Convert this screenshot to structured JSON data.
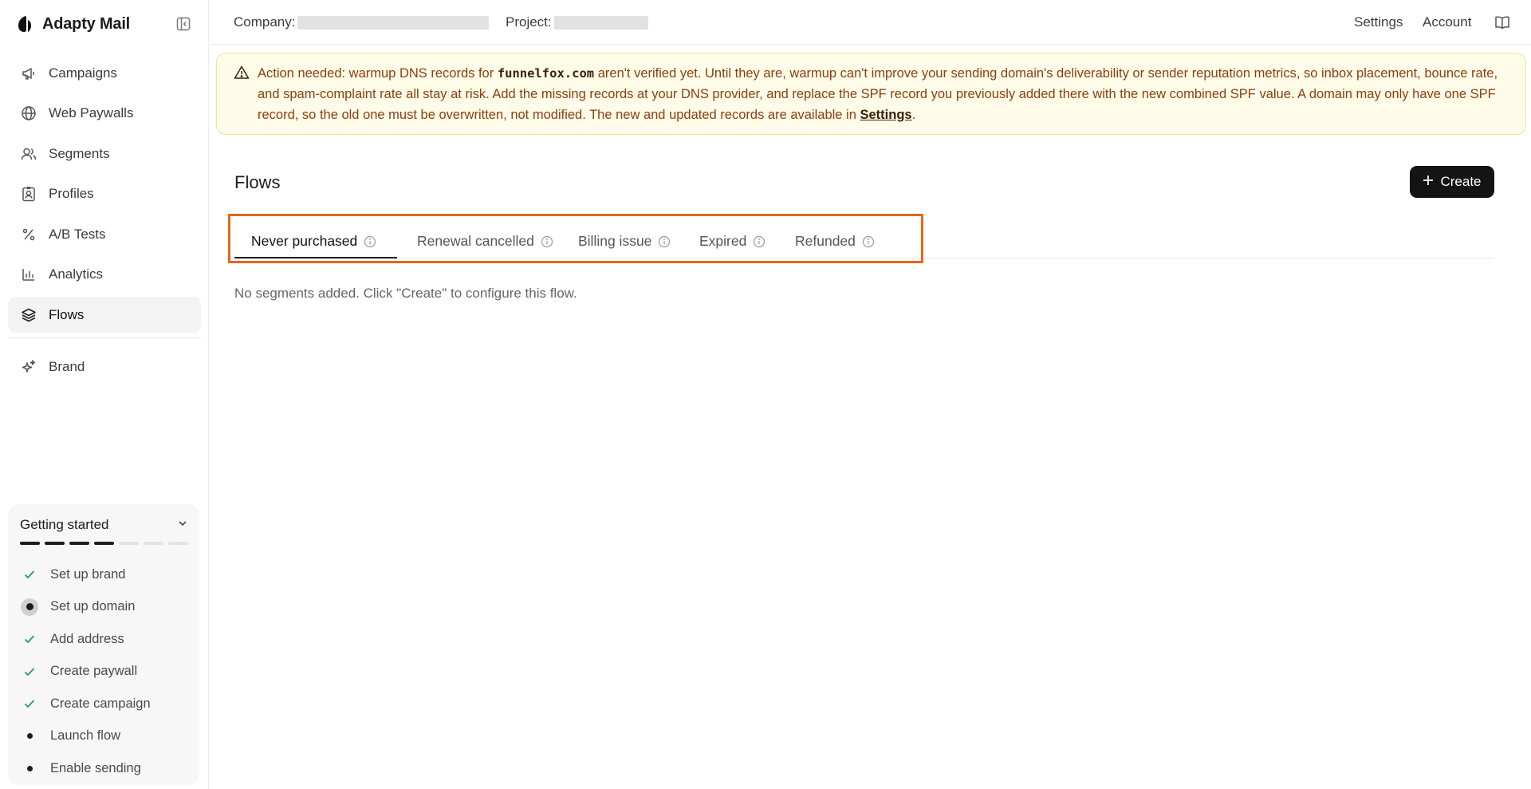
{
  "app": {
    "name": "Adapty Mail"
  },
  "sidebar": {
    "items": [
      {
        "label": "Campaigns",
        "icon": "megaphone-icon"
      },
      {
        "label": "Web Paywalls",
        "icon": "globe-icon"
      },
      {
        "label": "Segments",
        "icon": "users-icon"
      },
      {
        "label": "Profiles",
        "icon": "id-card-icon"
      },
      {
        "label": "A/B Tests",
        "icon": "percent-icon"
      },
      {
        "label": "Analytics",
        "icon": "bar-chart-icon"
      },
      {
        "label": "Flows",
        "icon": "layers-icon",
        "active": true
      }
    ],
    "secondary_items": [
      {
        "label": "Brand",
        "icon": "sparkles-icon"
      }
    ]
  },
  "getting_started": {
    "title": "Getting started",
    "progress": {
      "completed": 4,
      "total": 7
    },
    "items": [
      {
        "label": "Set up brand",
        "status": "done"
      },
      {
        "label": "Set up domain",
        "status": "current"
      },
      {
        "label": "Add address",
        "status": "done"
      },
      {
        "label": "Create paywall",
        "status": "done"
      },
      {
        "label": "Create campaign",
        "status": "done"
      },
      {
        "label": "Launch flow",
        "status": "pending"
      },
      {
        "label": "Enable sending",
        "status": "pending"
      }
    ]
  },
  "topbar": {
    "company_label": "Company:",
    "project_label": "Project:",
    "settings_label": "Settings",
    "account_label": "Account"
  },
  "banner": {
    "text_before": "Action needed: warmup DNS records for ",
    "domain": "funnelfox.com",
    "text_after": " aren't verified yet. Until they are, warmup can't improve your sending domain's deliverability or sender reputation metrics, so inbox placement, bounce rate, and spam-complaint rate all stay at risk. Add the missing records at your DNS provider, and replace the SPF record you previously added there with the new combined SPF value. A domain may only have one SPF record, so the old one must be overwritten, not modified. The new and updated records are available in ",
    "link_label": "Settings",
    "text_end": "."
  },
  "main": {
    "title": "Flows",
    "create_label": "Create",
    "tabs": [
      {
        "label": "Never purchased",
        "active": true
      },
      {
        "label": "Renewal cancelled"
      },
      {
        "label": "Billing issue"
      },
      {
        "label": "Expired"
      },
      {
        "label": "Refunded"
      }
    ],
    "empty_message": "No segments added. Click \"Create\" to configure this flow."
  },
  "colors": {
    "highlight_border": "#e8661a",
    "banner_bg": "#fefbe8",
    "banner_text": "#8a3f10",
    "check_green": "#1f9d6b",
    "primary_button": "#141414"
  }
}
